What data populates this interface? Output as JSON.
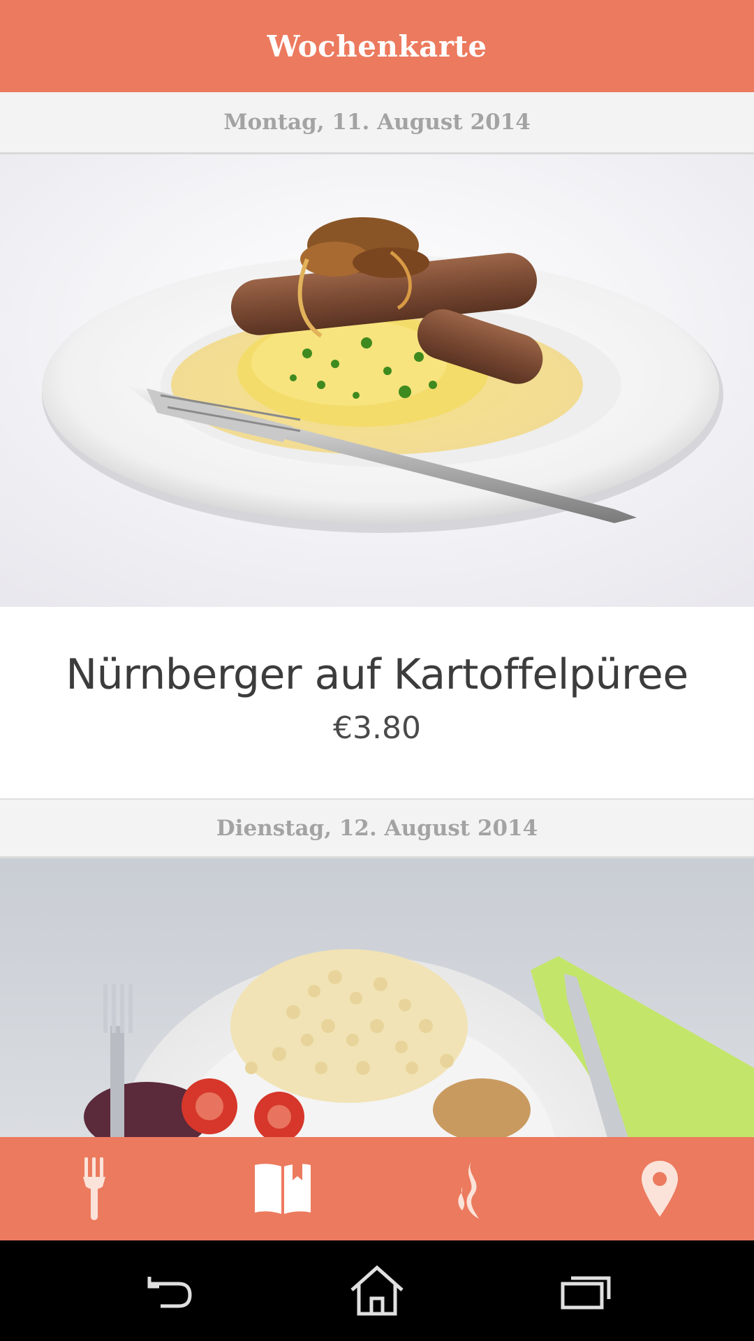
{
  "app_bar": {
    "title": "Wochenkarte"
  },
  "days": [
    {
      "date_label": "Montag, 11. August 2014",
      "dish": {
        "name": "Nürnberger auf Kartoffelpüree",
        "price": "€3.80"
      }
    },
    {
      "date_label": "Dienstag, 12. August 2014"
    }
  ],
  "bottom_nav": {
    "items": [
      {
        "icon": "fork-icon"
      },
      {
        "icon": "book-bookmark-icon"
      },
      {
        "icon": "steam-icon"
      },
      {
        "icon": "map-pin-icon"
      }
    ]
  },
  "system_nav": {
    "items": [
      {
        "icon": "back-icon"
      },
      {
        "icon": "home-icon"
      },
      {
        "icon": "recent-apps-icon"
      }
    ]
  },
  "colors": {
    "accent": "#ec7a5e",
    "header_text": "#ffffff",
    "day_header_text": "#a3a3a3"
  }
}
